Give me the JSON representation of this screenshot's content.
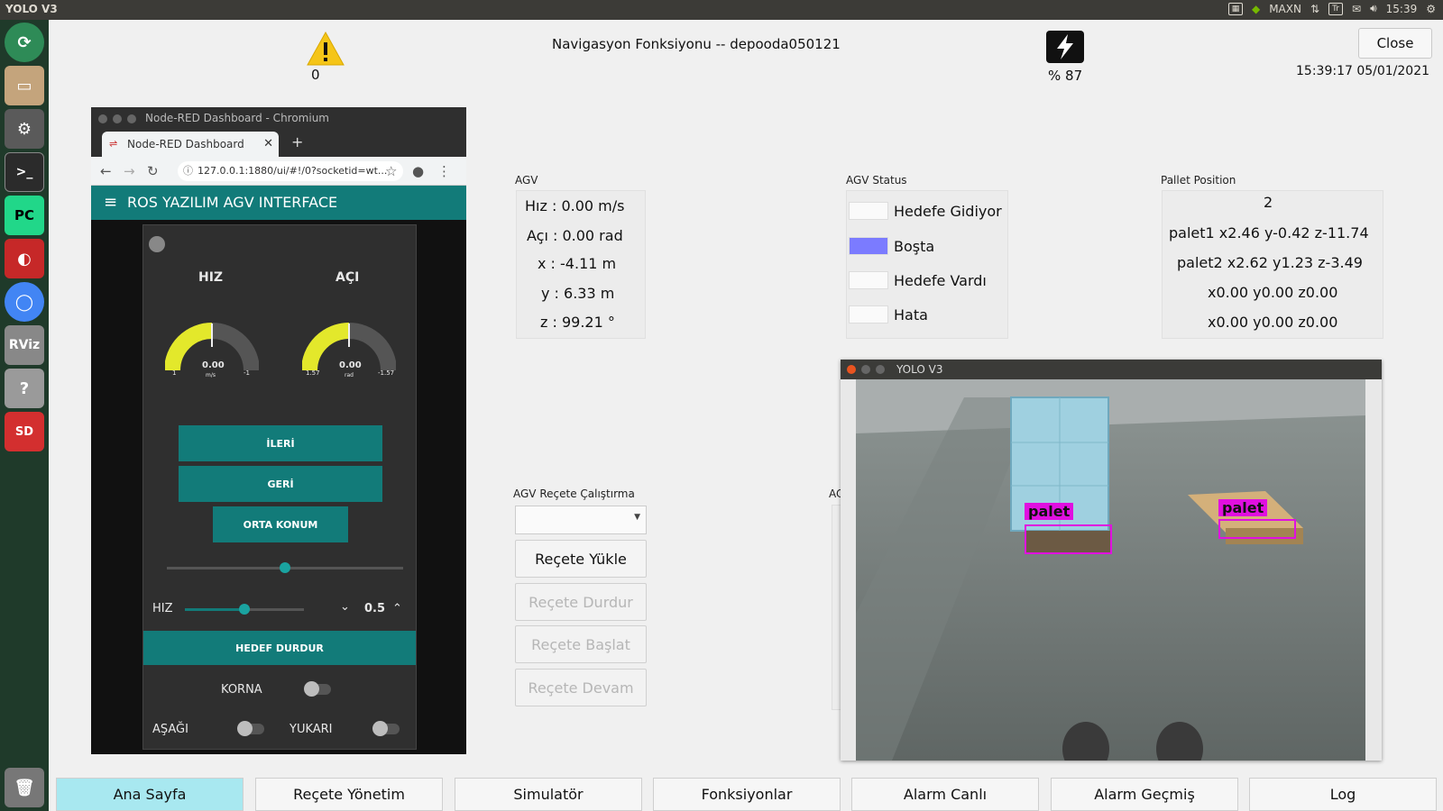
{
  "topbar": {
    "title": "YOLO V3",
    "tray_label": "MAXN",
    "time": "15:39"
  },
  "header": {
    "warning_count": "0",
    "nav_title": "Navigasyon Fonksiyonu -- depooda050121",
    "battery": "% 87",
    "close_label": "Close",
    "datetime": "15:39:17 05/01/2021"
  },
  "chromium": {
    "window_title": "Node-RED Dashboard - Chromium",
    "tab_title": "Node-RED Dashboard",
    "url": "127.0.0.1:1880/ui/#!/0?socketid=wt...",
    "dashboard_title": "ROS YAZILIM AGV INTERFACE",
    "gauge_speed": {
      "label": "HIZ",
      "value": "0.00",
      "unit": "m/s",
      "min": "1",
      "max": "-1",
      "level": 0.5
    },
    "gauge_angle": {
      "label": "AÇI",
      "value": "0.00",
      "unit": "rad",
      "min": "1.57",
      "max": "-1.57",
      "level": 0.5
    },
    "btn_forward": "İLERİ",
    "btn_back": "GERİ",
    "btn_center": "ORTA KONUM",
    "center_slider_level": 0.5,
    "speed_label": "HIZ",
    "speed_value": "0.5",
    "speed_slider_level": 0.5,
    "btn_stop": "HEDEF DURDUR",
    "horn_label": "KORNA",
    "down_label": "AŞAĞI",
    "up_label": "YUKARI"
  },
  "agv": {
    "section": "AGV",
    "speed": "Hız : 0.00  m/s",
    "angle": "Açı : 0.00 rad",
    "x": "x : -4.11 m",
    "y": "y : 6.33 m",
    "z": "z : 99.21 °"
  },
  "agv_status": {
    "section": "AGV Status",
    "items": [
      "Hedefe Gidiyor",
      "Boşta",
      "Hedefe Vardı",
      "Hata"
    ],
    "active_color": "#7b7bff"
  },
  "pallet": {
    "section": "Pallet Position",
    "count": "2",
    "lines": [
      "palet1 x2.46 y-0.42 z-11.74",
      "palet2 x2.62 y1.23 z-3.49",
      "x0.00 y0.00 z0.00",
      "x0.00 y0.00 z0.00"
    ]
  },
  "recipe": {
    "section": "AGV Reçete Çalıştırma",
    "load": "Reçete Yükle",
    "stop": "Reçete Durdur",
    "start": "Reçete Başlat",
    "resume": "Reçete Devam"
  },
  "yolo": {
    "title": "YOLO V3",
    "detections": [
      "palet",
      "palet"
    ],
    "partial_label": "AC"
  },
  "bottom_nav": [
    "Ana Sayfa",
    "Reçete Yönetim",
    "Simulatör",
    "Fonksiyonlar",
    "Alarm Canlı",
    "Alarm Geçmiş",
    "Log"
  ],
  "launcher_icons": [
    "system-update-icon",
    "file-manager-icon",
    "settings-icon",
    "terminal-icon",
    "pycharm-icon",
    "app-icon",
    "chromium-icon",
    "rviz-icon",
    "help-icon",
    "sd-card-icon",
    "trash-icon"
  ]
}
